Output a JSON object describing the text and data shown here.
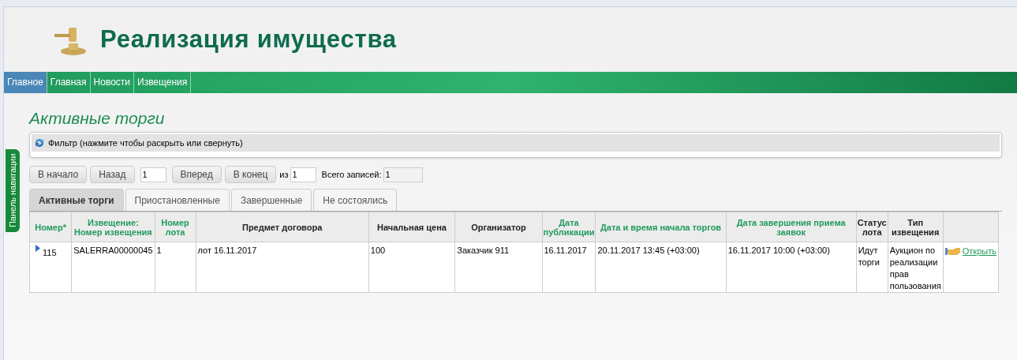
{
  "header": {
    "title": "Реализация имущества"
  },
  "nav": [
    {
      "label": "Главное",
      "selected": true
    },
    {
      "label": "Главная",
      "selected": false
    },
    {
      "label": "Новости",
      "selected": false
    },
    {
      "label": "Извещения",
      "selected": false
    }
  ],
  "side_tab": "Панель навигации",
  "page_title": "Активные торги",
  "filter": "Фильтр (нажмите чтобы раскрыть или свернуть)",
  "pager": {
    "first": "В начало",
    "prev": "Назад",
    "page": "1",
    "next": "Вперед",
    "last": "В конец",
    "of_label": "из",
    "pages": "1",
    "total_label": "Всего записей:",
    "total": "1"
  },
  "tabs": [
    {
      "label": "Активные торги",
      "selected": true
    },
    {
      "label": "Приостановленные",
      "selected": false
    },
    {
      "label": "Завершенные",
      "selected": false
    },
    {
      "label": "Не состоялись",
      "selected": false
    }
  ],
  "table": {
    "columns": [
      {
        "label": "Номер*",
        "sortable": true
      },
      {
        "label": "Извещение: Номер извещения",
        "sortable": true
      },
      {
        "label": "Номер лота",
        "sortable": true
      },
      {
        "label": "Предмет договора",
        "sortable": false
      },
      {
        "label": "Начальная цена",
        "sortable": false
      },
      {
        "label": "Организатор",
        "sortable": false
      },
      {
        "label": "Дата публикации",
        "sortable": true
      },
      {
        "label": "Дата и время начала торгов",
        "sortable": true
      },
      {
        "label": "Дата завершения приема заявок",
        "sortable": true
      },
      {
        "label": "Статус лота",
        "sortable": false
      },
      {
        "label": "Тип извещения",
        "sortable": false
      }
    ],
    "rows": [
      {
        "cells": [
          "115",
          "SALERRA00000045",
          "1",
          "лот 16.11.2017",
          "100",
          "Заказчик 911",
          "16.11.2017",
          "20.11.2017 13:45 (+03:00)",
          "16.11.2017 10:00 (+03:00)",
          "Идут торги",
          "Аукцион по реализации прав пользования"
        ],
        "action": "Открыть"
      }
    ]
  }
}
